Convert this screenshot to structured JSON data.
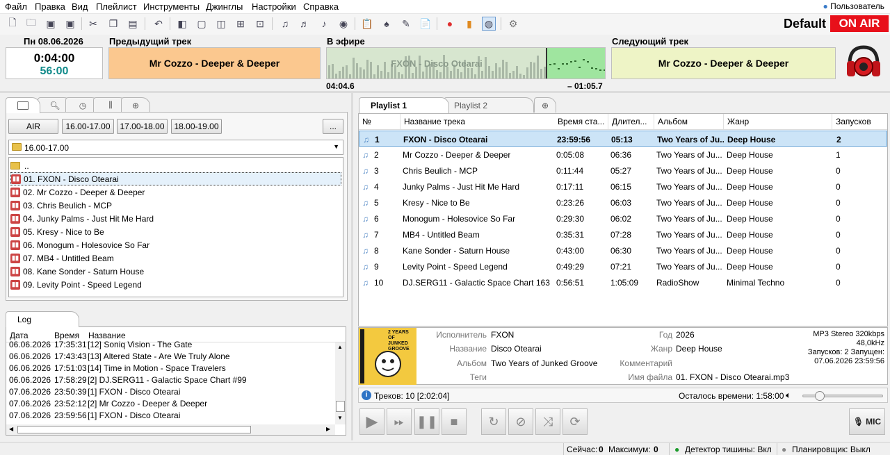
{
  "menu": [
    "Файл",
    "Правка",
    "Вид",
    "Плейлист",
    "Инструменты",
    "Джинглы",
    "Настройки",
    "Справка"
  ],
  "user_label": "Пользователь",
  "profile": "Default",
  "onair_label": "ON AIR",
  "clock": {
    "date": "Пн 08.06.2026",
    "time": "0:04:00",
    "seconds": "56:00"
  },
  "previous": {
    "header": "Предыдущий трек",
    "title": "Mr Cozzo - Deeper & Deeper",
    "color": "#fbc88f"
  },
  "onair": {
    "header": "В эфире",
    "title": "FXON - Disco Otearai",
    "elapsed": "04:04.6",
    "remaining": "– 01:05.7",
    "progress": 0.79
  },
  "next": {
    "header": "Следующий трек",
    "title": "Mr Cozzo - Deeper & Deeper",
    "color": "#eef4c6"
  },
  "left_panel": {
    "tabs": [
      "folder-icon",
      "search-icon",
      "clock-icon",
      "equalizer-icon",
      "add-tab-icon"
    ],
    "buttons": [
      "AIR",
      "16.00-17.00",
      "17.00-18.00",
      "18.00-19.00",
      "..."
    ],
    "folder_select": "16.00-17.00",
    "parent": "..",
    "files": [
      "01. FXON - Disco Otearai",
      "02. Mr Cozzo - Deeper & Deeper",
      "03. Chris Beulich - MCP",
      "04. Junky Palms - Just Hit Me Hard",
      "05. Kresy - Nice to Be",
      "06. Monogum - Holesovice So Far",
      "07. MB4 - Untitled Beam",
      "08. Kane Sonder - Saturn House",
      "09. Levity Point - Speed Legend"
    ]
  },
  "log": {
    "tab": "Log",
    "columns": [
      "Дата",
      "Время",
      "Название"
    ],
    "rows": [
      [
        "06.06.2026",
        "17:35:31",
        "[12]  Soniq Vision - The Gate"
      ],
      [
        "06.06.2026",
        "17:43:43",
        "[13]  Altered State - Are We Truly Alone"
      ],
      [
        "06.06.2026",
        "17:51:03",
        "[14]  Time in Motion - Space Travelers"
      ],
      [
        "06.06.2026",
        "17:58:29",
        "[2]  DJ.SERG11 - Galactic Space Chart #99"
      ],
      [
        "07.06.2026",
        "23:50:39",
        "[1]  FXON - Disco Otearai"
      ],
      [
        "07.06.2026",
        "23:52:12",
        "[2]  Mr Cozzo - Deeper & Deeper"
      ],
      [
        "07.06.2026",
        "23:59:56",
        "[1]  FXON - Disco Otearai"
      ]
    ]
  },
  "playlist": {
    "tabs": [
      "Playlist 1",
      "Playlist 2"
    ],
    "columns": [
      "№",
      "Название трека",
      "Время ста...",
      "Длител...",
      "Альбом",
      "Жанр",
      "Запусков"
    ],
    "rows": [
      [
        "1",
        "FXON - Disco Otearai",
        "23:59:56",
        "05:13",
        "Two Years of Ju...",
        "Deep House",
        "2"
      ],
      [
        "2",
        "Mr Cozzo - Deeper & Deeper",
        "0:05:08",
        "06:36",
        "Two Years of Ju...",
        "Deep House",
        "1"
      ],
      [
        "3",
        "Chris Beulich - MCP",
        "0:11:44",
        "05:27",
        "Two Years of Ju...",
        "Deep House",
        "0"
      ],
      [
        "4",
        "Junky Palms - Just Hit Me Hard",
        "0:17:11",
        "06:15",
        "Two Years of Ju...",
        "Deep House",
        "0"
      ],
      [
        "5",
        "Kresy - Nice to Be",
        "0:23:26",
        "06:03",
        "Two Years of Ju...",
        "Deep House",
        "0"
      ],
      [
        "6",
        "Monogum - Holesovice So Far",
        "0:29:30",
        "06:02",
        "Two Years of Ju...",
        "Deep House",
        "0"
      ],
      [
        "7",
        "MB4 - Untitled Beam",
        "0:35:31",
        "07:28",
        "Two Years of Ju...",
        "Deep House",
        "0"
      ],
      [
        "8",
        "Kane Sonder - Saturn House",
        "0:43:00",
        "06:30",
        "Two Years of Ju...",
        "Deep House",
        "0"
      ],
      [
        "9",
        "Levity Point - Speed Legend",
        "0:49:29",
        "07:21",
        "Two Years of Ju...",
        "Deep House",
        "0"
      ],
      [
        "10",
        "DJ.SERG11 - Galactic Space Chart 163",
        "0:56:51",
        "1:05:09",
        "RadioShow",
        "Minimal Techno",
        "0"
      ]
    ]
  },
  "info": {
    "labels": {
      "artist": "Исполнитель",
      "title": "Название",
      "album": "Альбом",
      "tags": "Теги",
      "year": "Год",
      "genre": "Жанр",
      "comment": "Комментарий",
      "filename": "Имя файла"
    },
    "artist": "FXON",
    "title": "Disco Otearai",
    "album": "Two Years of Junked Groove",
    "tags": "",
    "year": "2026",
    "genre": "Deep House",
    "comment": "",
    "filename": "01. FXON - Disco Otearai.mp3",
    "format": "MP3 Stereo 320kbps",
    "samplerate": "48,0kHz",
    "launches": "Запусков: 2  Запущен:",
    "launched_at": "07.06.2026 23:59:56",
    "cover_text": "2 YEARS OF JUNKED GROOVE"
  },
  "summary": {
    "tracks": "Треков: 10 [2:02:04]",
    "remaining": "Осталось времени: 1:58:00",
    "volume": 0.1
  },
  "mic_label": "MIC",
  "status": {
    "now": "Сейчас:",
    "now_val": "0",
    "max": "Максимум:",
    "max_val": "0",
    "silence": "Детектор тишины: Вкл",
    "scheduler": "Планировщик: Выкл"
  }
}
